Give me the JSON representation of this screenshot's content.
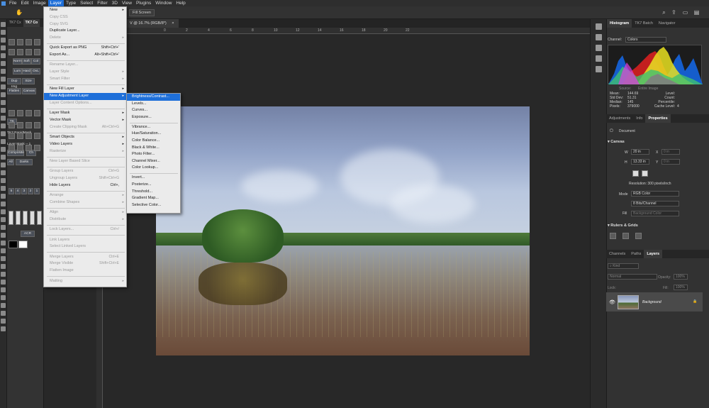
{
  "menubar": [
    "File",
    "Edit",
    "Image",
    "Layer",
    "Type",
    "Select",
    "Filter",
    "3D",
    "View",
    "Plugins",
    "Window",
    "Help"
  ],
  "options": {
    "fill_screen": "Fill Screen"
  },
  "doc_tab": {
    "title": "V @ 16.7% (RGB/8*)",
    "close": "×"
  },
  "ruler_ticks": [
    "0",
    "2",
    "4",
    "6",
    "8",
    "10",
    "12",
    "14",
    "16",
    "18",
    "20",
    "22"
  ],
  "left_panel": {
    "tabs": [
      "TK7 Cx",
      "TK7 Co"
    ],
    "buttons": [
      "Norm",
      "Soft",
      "Col",
      "Lum",
      "Hard",
      "OvL",
      "Dup Img",
      "Size",
      "Flatten",
      "Canvas",
      "TK",
      "TK7 RapidMask",
      "Layer Mask -- 1",
      "Composite",
      "Ch",
      "All",
      "Darks",
      "ACR"
    ],
    "numbers": [
      "5",
      "4",
      "3",
      "2",
      "1"
    ]
  },
  "layer_menu": {
    "items": [
      {
        "label": "New",
        "arrow": true
      },
      {
        "label": "Copy CSS",
        "disabled": true
      },
      {
        "label": "Copy SVG",
        "disabled": true
      },
      {
        "label": "Duplicate Layer..."
      },
      {
        "label": "Delete",
        "arrow": true,
        "disabled": true
      },
      {
        "sep": true
      },
      {
        "label": "Quick Export as PNG",
        "shortcut": "Shift+Ctrl+'"
      },
      {
        "label": "Export As...",
        "shortcut": "Alt+Shift+Ctrl+'"
      },
      {
        "sep": true
      },
      {
        "label": "Rename Layer...",
        "disabled": true
      },
      {
        "label": "Layer Style",
        "arrow": true,
        "disabled": true
      },
      {
        "label": "Smart Filter",
        "arrow": true,
        "disabled": true
      },
      {
        "sep": true
      },
      {
        "label": "New Fill Layer",
        "arrow": true
      },
      {
        "label": "New Adjustment Layer",
        "arrow": true,
        "highlight": true
      },
      {
        "label": "Layer Content Options...",
        "disabled": true
      },
      {
        "sep": true
      },
      {
        "label": "Layer Mask",
        "arrow": true
      },
      {
        "label": "Vector Mask",
        "arrow": true
      },
      {
        "label": "Create Clipping Mask",
        "shortcut": "Alt+Ctrl+G",
        "disabled": true
      },
      {
        "sep": true
      },
      {
        "label": "Smart Objects",
        "arrow": true
      },
      {
        "label": "Video Layers",
        "arrow": true
      },
      {
        "label": "Rasterize",
        "arrow": true,
        "disabled": true
      },
      {
        "sep": true
      },
      {
        "label": "New Layer Based Slice",
        "disabled": true
      },
      {
        "sep": true
      },
      {
        "label": "Group Layers",
        "shortcut": "Ctrl+G",
        "disabled": true
      },
      {
        "label": "Ungroup Layers",
        "shortcut": "Shift+Ctrl+G",
        "disabled": true
      },
      {
        "label": "Hide Layers",
        "shortcut": "Ctrl+,"
      },
      {
        "sep": true
      },
      {
        "label": "Arrange",
        "arrow": true,
        "disabled": true
      },
      {
        "label": "Combine Shapes",
        "arrow": true,
        "disabled": true
      },
      {
        "sep": true
      },
      {
        "label": "Align",
        "arrow": true,
        "disabled": true
      },
      {
        "label": "Distribute",
        "arrow": true,
        "disabled": true
      },
      {
        "sep": true
      },
      {
        "label": "Lock Layers...",
        "shortcut": "Ctrl+/",
        "disabled": true
      },
      {
        "sep": true
      },
      {
        "label": "Link Layers",
        "disabled": true
      },
      {
        "label": "Select Linked Layers",
        "disabled": true
      },
      {
        "sep": true
      },
      {
        "label": "Merge Layers",
        "shortcut": "Ctrl+E",
        "disabled": true
      },
      {
        "label": "Merge Visible",
        "shortcut": "Shift+Ctrl+E",
        "disabled": true
      },
      {
        "label": "Flatten Image",
        "disabled": true
      },
      {
        "sep": true
      },
      {
        "label": "Matting",
        "arrow": true,
        "disabled": true
      }
    ]
  },
  "adjustment_submenu": {
    "items": [
      {
        "label": "Brightness/Contrast...",
        "highlight": true
      },
      {
        "label": "Levels..."
      },
      {
        "label": "Curves..."
      },
      {
        "label": "Exposure..."
      },
      {
        "sep": true
      },
      {
        "label": "Vibrance..."
      },
      {
        "label": "Hue/Saturation..."
      },
      {
        "label": "Color Balance..."
      },
      {
        "label": "Black & White..."
      },
      {
        "label": "Photo Filter..."
      },
      {
        "label": "Channel Mixer..."
      },
      {
        "label": "Color Lookup..."
      },
      {
        "sep": true
      },
      {
        "label": "Invert..."
      },
      {
        "label": "Posterize..."
      },
      {
        "label": "Threshold..."
      },
      {
        "label": "Gradient Map..."
      },
      {
        "label": "Selective Color..."
      }
    ]
  },
  "right_panel": {
    "top_tabs": [
      "Histogram",
      "TK7 Batch",
      "Navigator"
    ],
    "channel_label": "Channel:",
    "channel_value": "Colors",
    "source_label": "Source:",
    "source_value": "Entire Image",
    "stats_left": [
      {
        "label": "Mean:",
        "value": "144.69"
      },
      {
        "label": "Std Dev:",
        "value": "51.31"
      },
      {
        "label": "Median:",
        "value": "145"
      },
      {
        "label": "Pixels:",
        "value": "379000"
      }
    ],
    "stats_right": [
      {
        "label": "Level:",
        "value": ""
      },
      {
        "label": "Count:",
        "value": ""
      },
      {
        "label": "Percentile:",
        "value": ""
      },
      {
        "label": "Cache Level:",
        "value": "4"
      }
    ],
    "mid_tabs": [
      "Adjustments",
      "Info",
      "Properties"
    ],
    "document_label": "Document",
    "canvas_header": "Canvas",
    "w_label": "W",
    "w_value": "20 in",
    "h_label": "H",
    "h_value": "13.33 in",
    "x_label": "X",
    "x_value": "0 in",
    "y_label": "Y",
    "y_value": "0 in",
    "resolution": "Resolution: 300 pixels/inch",
    "mode_label": "Mode",
    "mode_value": "RGB Color",
    "bits_value": "8 Bits/Channel",
    "fill_label": "Fill",
    "fill_value": "Background Color",
    "rulers_header": "Rulers & Grids",
    "layer_tabs": [
      "Channels",
      "Paths",
      "Layers"
    ],
    "kind_label": "Kind",
    "blend_mode": "Normal",
    "opacity_label": "Opacity:",
    "opacity_value": "100%",
    "lock_label": "Lock:",
    "fill2_label": "Fill:",
    "fill2_value": "100%",
    "layer_name": "Background"
  }
}
